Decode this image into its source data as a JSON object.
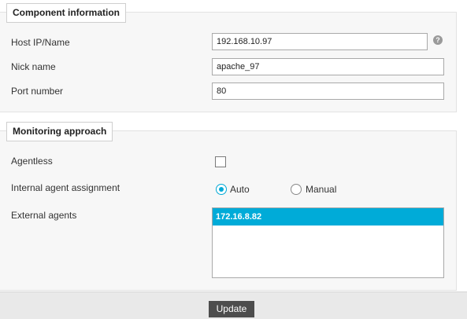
{
  "component_info": {
    "legend": "Component information",
    "host": {
      "label": "Host IP/Name",
      "value": "192.168.10.97"
    },
    "nick": {
      "label": "Nick name",
      "value": "apache_97"
    },
    "port": {
      "label": "Port number",
      "value": "80"
    },
    "help_icon": "?"
  },
  "monitoring": {
    "legend": "Monitoring approach",
    "agentless": {
      "label": "Agentless",
      "checked": false
    },
    "internal_agent": {
      "label": "Internal agent assignment",
      "options": [
        {
          "label": "Auto",
          "selected": true
        },
        {
          "label": "Manual",
          "selected": false
        }
      ]
    },
    "external_agents": {
      "label": "External agents",
      "items": [
        {
          "label": "172.16.8.82",
          "selected": true
        }
      ]
    }
  },
  "footer": {
    "update_label": "Update"
  },
  "colors": {
    "accent": "#00abd8",
    "button_bg": "#4d4d4d"
  }
}
